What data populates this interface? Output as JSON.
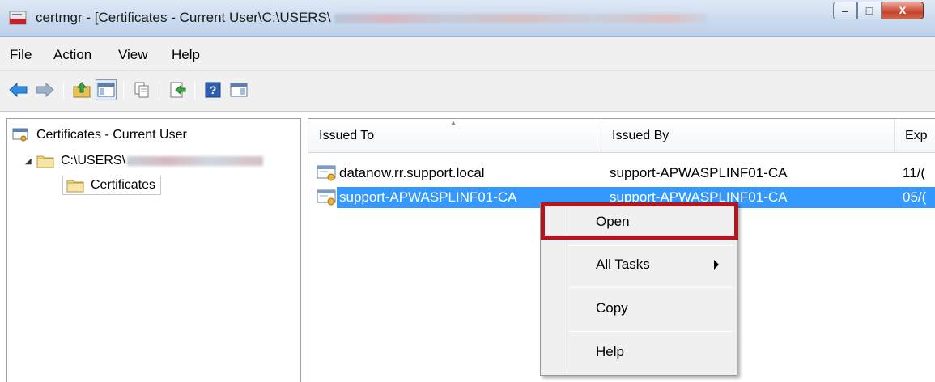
{
  "window": {
    "title": "certmgr - [Certificates - Current User\\C:\\USERS\\",
    "buttons": {
      "minimize": "–",
      "maximize": "□",
      "close": "x"
    }
  },
  "menu": [
    "File",
    "Action",
    "View",
    "Help"
  ],
  "toolbar": {
    "icons": [
      "back-icon",
      "forward-icon",
      "up-folder-icon",
      "show-hide-console-tree-icon",
      "copy-icon",
      "export-list-icon",
      "help-icon",
      "action-pane-icon"
    ]
  },
  "tree": {
    "root": "Certificates - Current User",
    "user_path": "C:\\USERS\\",
    "store": "Certificates"
  },
  "list": {
    "columns": [
      "Issued To",
      "Issued By",
      "Exp"
    ],
    "rows": [
      {
        "issued_to": "datanow.rr.support.local",
        "issued_by": "support-APWASPLINF01-CA",
        "exp": "11/("
      },
      {
        "issued_to": "support-APWASPLINF01-CA",
        "issued_by": "support-APWASPLINF01-CA",
        "exp": "05/("
      }
    ]
  },
  "context_menu": {
    "items": [
      "Open",
      "All Tasks",
      "Copy",
      "Help"
    ],
    "highlighted": "Open"
  },
  "colors": {
    "selection": "#3399ff",
    "highlight_box": "#b3161c"
  }
}
